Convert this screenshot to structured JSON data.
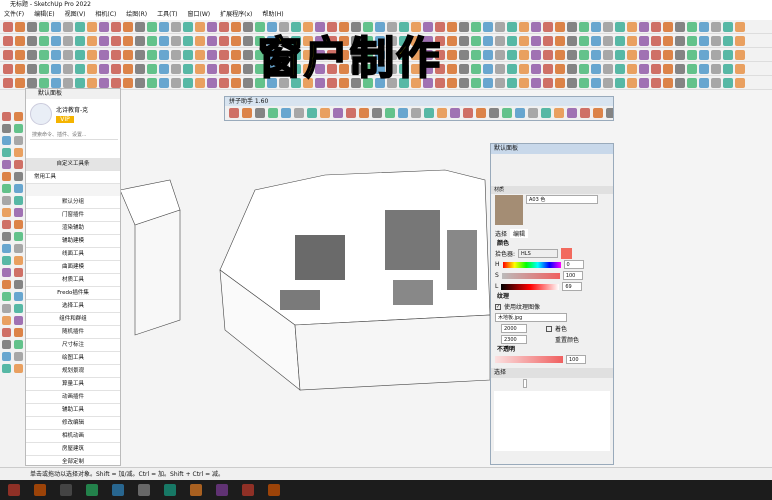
{
  "window": {
    "title": "无标题 - SketchUp Pro 2022"
  },
  "menu": [
    "文件(F)",
    "编辑(E)",
    "视图(V)",
    "相机(C)",
    "绘图(R)",
    "工具(T)",
    "窗口(W)",
    "扩展程序(x)",
    "帮助(H)"
  ],
  "overlay_title": "窗户制作",
  "tray": {
    "title": "默认面板",
    "brand": "北诗教育-克",
    "badge": "VIP",
    "search_placeholder": "搜索命令、插件、设置...",
    "custom_toolbar": "自定义工具条",
    "common_tools": "常用工具",
    "items": [
      "默认分组",
      "门窗插件",
      "渲染辅助",
      "辅助建模",
      "线面工具",
      "曲面建模",
      "材质工具",
      "Fredo插件集",
      "选择工具",
      "组件和群组",
      "随机插件",
      "尺寸标注",
      "绘图工具",
      "规划景观",
      "算量工具",
      "动画插件",
      "辅助工具",
      "修改编辑",
      "相机动画",
      "房屋建筑",
      "全部定制"
    ]
  },
  "float_toolbar": {
    "title": "拼子助手 1.60"
  },
  "panel": {
    "title": "默认面板",
    "materials_label": "材质",
    "material_name": "A03 色",
    "tabs": [
      "选择",
      "编辑"
    ],
    "color_label": "颜色",
    "picker_label": "拾色器:",
    "picker_value": "HLS",
    "h": {
      "label": "H",
      "value": "0"
    },
    "s": {
      "label": "S",
      "value": "100"
    },
    "l": {
      "label": "L",
      "value": "69"
    },
    "texture_label": "纹理",
    "use_texture": "使用纹理图像",
    "texture_file": "木地板.jpg",
    "width": "2000 mm",
    "height": "2300 mm",
    "colorize": "着色",
    "reset_color": "重置颜色",
    "opacity_label": "不透明",
    "opacity_value": "100",
    "select_label": "选择"
  },
  "colors": {
    "swatch": "#f26a5e",
    "accent": "#ffe600"
  },
  "status": {
    "text": "单击或拖动以选择对象。Shift = 加/减。Ctrl = 加。Shift + Ctrl = 减。"
  }
}
